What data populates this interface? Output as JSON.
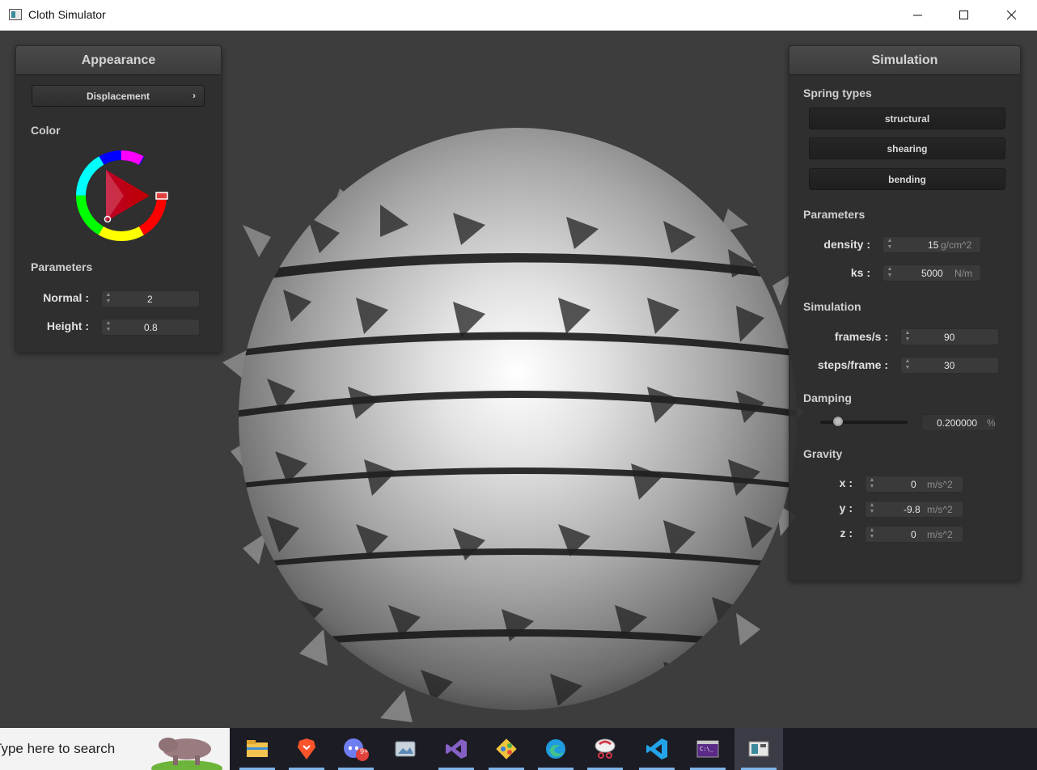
{
  "window": {
    "title": "Cloth Simulator",
    "icon": "app-window-icon",
    "controls": [
      "minimize-icon",
      "maximize-icon",
      "close-icon"
    ]
  },
  "appearance": {
    "header": "Appearance",
    "shader_button": "Displacement",
    "color_label": "Color",
    "color_value": "#b30000",
    "parameters_label": "Parameters",
    "normal_label": "Normal :",
    "normal_value": "2",
    "height_label": "Height :",
    "height_value": "0.8"
  },
  "simulation": {
    "header": "Simulation",
    "spring_types_label": "Spring types",
    "spring_buttons": [
      "structural",
      "shearing",
      "bending"
    ],
    "parameters_label": "Parameters",
    "density_label": "density :",
    "density_value": "15",
    "density_unit": "g/cm^2",
    "ks_label": "ks :",
    "ks_value": "5000",
    "ks_unit": "N/m",
    "simulation_label": "Simulation",
    "fps_label": "frames/s :",
    "fps_value": "90",
    "steps_label": "steps/frame :",
    "steps_value": "30",
    "damping_label": "Damping",
    "damping_slider_fraction": 0.2,
    "damping_value": "0.200000",
    "damping_unit": "%",
    "gravity_label": "Gravity",
    "gx_label": "x :",
    "gx_value": "0",
    "gy_label": "y :",
    "gy_value": "-9.8",
    "gz_label": "z :",
    "gz_value": "0",
    "gravity_unit": "m/s^2"
  },
  "taskbar": {
    "search_placeholder": "Type here to search",
    "items": [
      "file-explorer-icon",
      "brave-browser-icon",
      "discord-icon",
      "photos-icon",
      "visual-studio-icon",
      "git-icon",
      "edge-browser-icon",
      "snipping-tool-icon",
      "vscode-icon",
      "terminal-icon",
      "cloth-simulator-icon"
    ],
    "discord_badge": "9+"
  }
}
